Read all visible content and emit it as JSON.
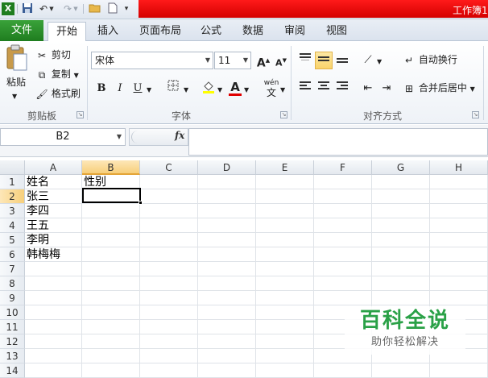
{
  "window": {
    "title": "工作簿1"
  },
  "ribbon_tabs": [
    "文件",
    "开始",
    "插入",
    "页面布局",
    "公式",
    "数据",
    "审阅",
    "视图"
  ],
  "clipboard": {
    "paste": "粘贴",
    "cut": "剪切",
    "copy": "复制",
    "format_painter": "格式刷",
    "group": "剪贴板"
  },
  "font": {
    "name": "宋体",
    "size": "11",
    "group": "字体",
    "grow": "A",
    "shrink": "A",
    "bold": "B",
    "italic": "I",
    "underline": "U",
    "font_color": "A",
    "phonetic": "wén"
  },
  "alignment": {
    "wrap_text": "自动换行",
    "merge_center": "合并后居中",
    "group": "对齐方式"
  },
  "formula_bar": {
    "name_box": "B2",
    "fx": "fx",
    "value": ""
  },
  "columns": [
    "A",
    "B",
    "C",
    "D",
    "E",
    "F",
    "G",
    "H"
  ],
  "rows": [
    "1",
    "2",
    "3",
    "4",
    "5",
    "6",
    "7",
    "8",
    "9",
    "10",
    "11",
    "12",
    "13",
    "14"
  ],
  "cells": {
    "A1": "姓名",
    "B1": "性别",
    "A2": "张三",
    "A3": "李四",
    "A4": "王五",
    "A5": "李明",
    "A6": "韩梅梅"
  },
  "selected_cell": "B2",
  "watermark": {
    "brand": "百科全说",
    "slogan": "助你轻松解决"
  },
  "colors": {
    "file_tab": "#2a8f2a",
    "selection_header": "#f7cf7a",
    "title_bar_red": "#e60000",
    "watermark_green": "#2aa147"
  }
}
